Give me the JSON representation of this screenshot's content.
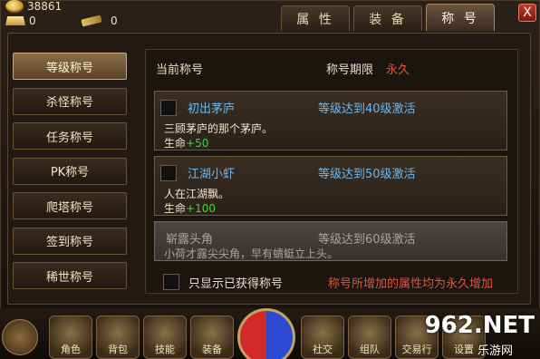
{
  "currency": {
    "gold": "38861",
    "ingot": "0",
    "ticket": "0"
  },
  "tabs": [
    {
      "label": "属 性"
    },
    {
      "label": "装 备"
    },
    {
      "label": "称 号"
    }
  ],
  "close_label": "X",
  "sidebar": {
    "items": [
      {
        "label": "等级称号"
      },
      {
        "label": "杀怪称号"
      },
      {
        "label": "任务称号"
      },
      {
        "label": "PK称号"
      },
      {
        "label": "爬塔称号"
      },
      {
        "label": "签到称号"
      },
      {
        "label": "稀世称号"
      }
    ]
  },
  "header": {
    "current_label": "当前称号",
    "period_label": "称号期限",
    "period_value": "永久"
  },
  "titles": [
    {
      "name": "初出茅庐",
      "condition": "等级达到40级激活",
      "desc": "三顾茅庐的那个茅庐。",
      "attr_label": "生命",
      "attr_value": "+50"
    },
    {
      "name": "江湖小虾",
      "condition": "等级达到50级激活",
      "desc": "人在江湖飘。",
      "attr_label": "生命",
      "attr_value": "+100"
    },
    {
      "name": "崭露头角",
      "condition": "等级达到60级激活",
      "desc": "小荷才露尖尖角，早有蜻蜓立上头。"
    }
  ],
  "footer": {
    "filter_label": "只显示已获得称号",
    "note": "称号所增加的属性均为永久增加"
  },
  "bottom_bar": [
    {
      "label": "角色"
    },
    {
      "label": "背包"
    },
    {
      "label": "技能"
    },
    {
      "label": "装备"
    },
    {
      "label": "社交"
    },
    {
      "label": "组队"
    },
    {
      "label": "交易行"
    },
    {
      "label": "设置"
    }
  ],
  "watermark": {
    "main": "962.NET",
    "sub": "乐游网"
  }
}
